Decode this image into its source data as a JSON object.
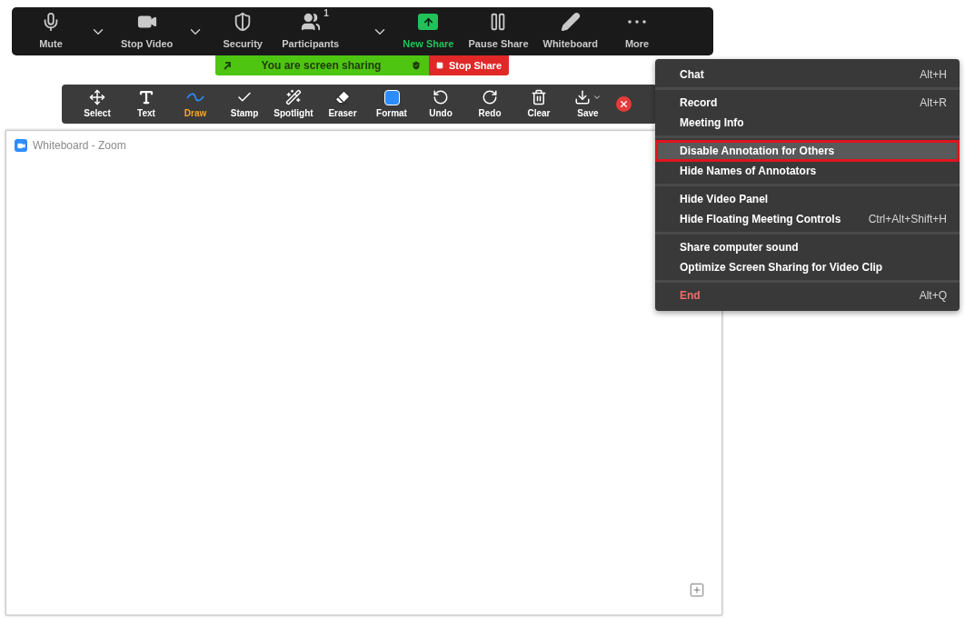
{
  "meeting_controls": [
    {
      "label": "Mute",
      "dropdown": true,
      "highlighted": false
    },
    {
      "label": "Stop Video",
      "dropdown": true,
      "highlighted": false
    },
    {
      "label": "Security",
      "dropdown": false,
      "highlighted": false
    },
    {
      "label": "Participants",
      "badge": "1",
      "dropdown": true,
      "highlighted": false
    },
    {
      "label": "New Share",
      "dropdown": false,
      "highlighted": true
    },
    {
      "label": "Pause Share",
      "dropdown": false,
      "highlighted": false
    },
    {
      "label": "Whiteboard",
      "dropdown": false,
      "highlighted": false
    },
    {
      "label": "More",
      "dropdown": false,
      "highlighted": false
    }
  ],
  "share_banner": {
    "text": "You are screen sharing",
    "stop_label": "Stop Share"
  },
  "annotation_tools": [
    {
      "label": "Select",
      "selected": false
    },
    {
      "label": "Text",
      "selected": false
    },
    {
      "label": "Draw",
      "selected": true
    },
    {
      "label": "Stamp",
      "selected": false
    },
    {
      "label": "Spotlight",
      "selected": false
    },
    {
      "label": "Eraser",
      "selected": false
    },
    {
      "label": "Format",
      "selected": false
    },
    {
      "label": "Undo",
      "selected": false
    },
    {
      "label": "Redo",
      "selected": false
    },
    {
      "label": "Clear",
      "selected": false
    },
    {
      "label": "Save",
      "selected": false
    }
  ],
  "whiteboard": {
    "title": "Whiteboard - Zoom"
  },
  "more_menu": [
    [
      {
        "label": "Chat",
        "shortcut": "Alt+H",
        "kind": "normal",
        "selected": false
      }
    ],
    [
      {
        "label": "Record",
        "shortcut": "Alt+R",
        "kind": "normal",
        "selected": false
      },
      {
        "label": "Meeting Info",
        "kind": "normal",
        "selected": false
      }
    ],
    [
      {
        "label": "Disable Annotation for Others",
        "kind": "normal",
        "selected": true
      },
      {
        "label": "Hide Names of Annotators",
        "kind": "normal",
        "selected": false
      }
    ],
    [
      {
        "label": "Hide Video Panel",
        "kind": "normal",
        "selected": false
      },
      {
        "label": "Hide Floating Meeting Controls",
        "shortcut": "Ctrl+Alt+Shift+H",
        "kind": "normal",
        "selected": false
      }
    ],
    [
      {
        "label": "Share computer sound",
        "kind": "normal",
        "selected": false
      },
      {
        "label": "Optimize Screen Sharing for Video Clip",
        "kind": "normal",
        "selected": false
      }
    ],
    [
      {
        "label": "End",
        "shortcut": "Alt+Q",
        "kind": "danger",
        "selected": false
      }
    ]
  ]
}
